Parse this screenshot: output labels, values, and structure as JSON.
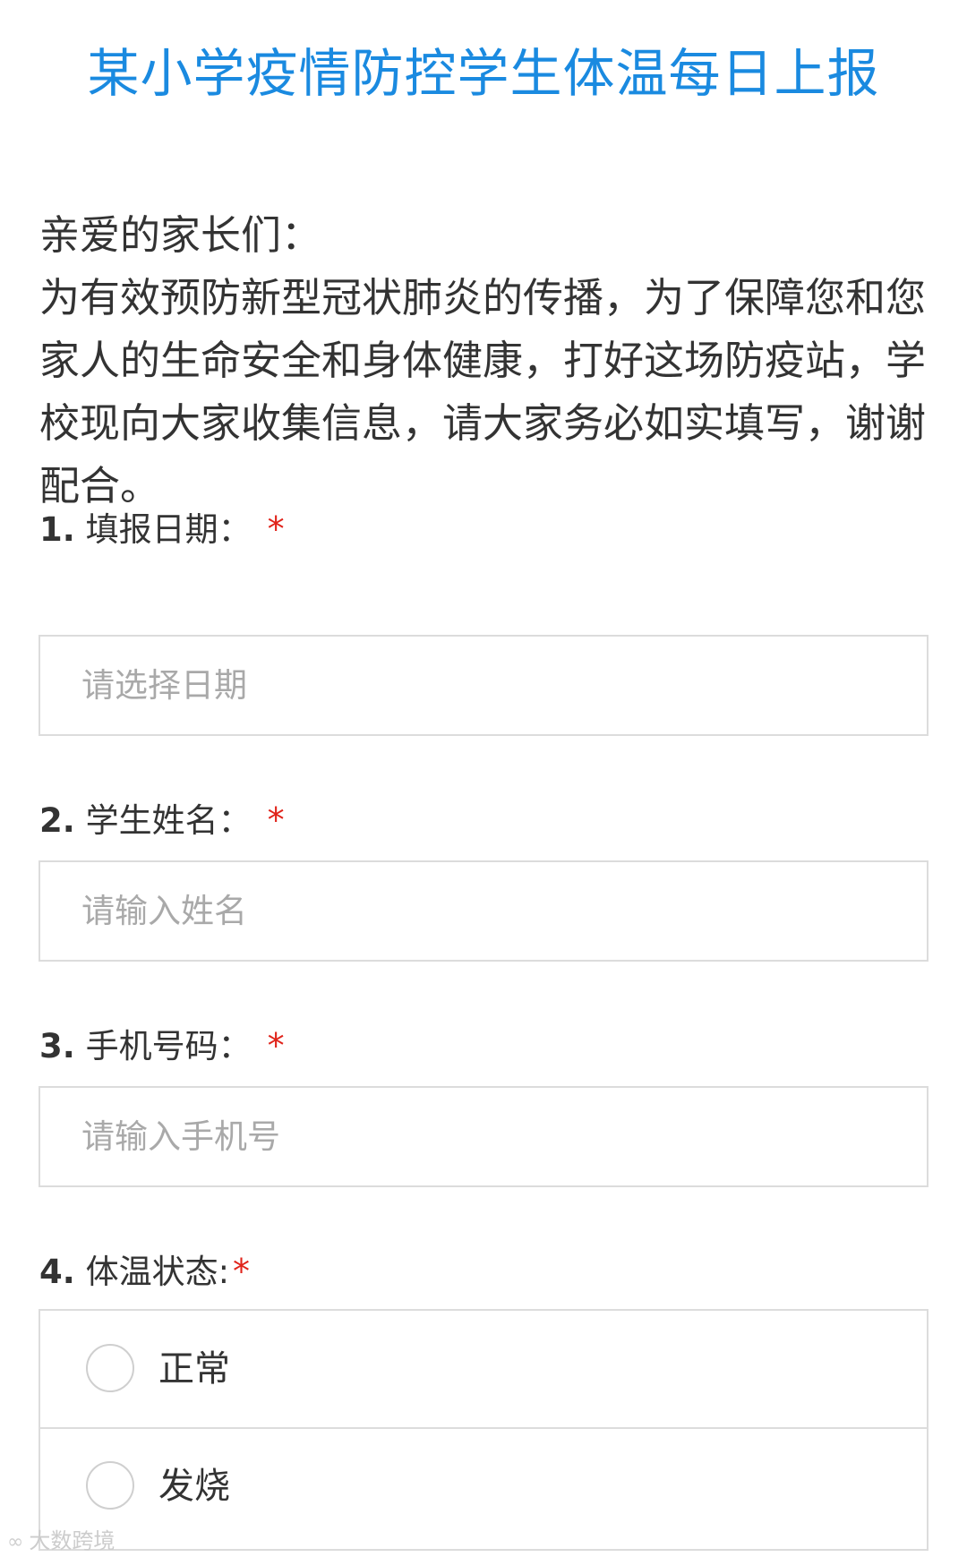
{
  "form": {
    "title": "某小学疫情防控学生体温每日上报",
    "greeting": "亲爱的家长们：",
    "intro": "为有效预防新型冠状肺炎的传播，为了保障您和您家人的生命安全和身体健康，打好这场防疫站，学校现向大家收集信息，请大家务必如实填写，谢谢配合。"
  },
  "questions": [
    {
      "number": "1.",
      "label": "填报日期：",
      "required": "*",
      "placeholder": "请选择日期",
      "value": ""
    },
    {
      "number": "2.",
      "label": "学生姓名：",
      "required": "*",
      "placeholder": "请输入姓名",
      "value": ""
    },
    {
      "number": "3.",
      "label": "手机号码：",
      "required": "*",
      "placeholder": "请输入手机号",
      "value": ""
    },
    {
      "number": "4.",
      "label": "体温状态:",
      "required": "*",
      "options": [
        "正常",
        "发烧"
      ]
    }
  ],
  "watermark": {
    "icon": "watermark-logo-icon",
    "text": "大数跨境"
  },
  "colors": {
    "title": "#1a8ae0",
    "required": "#e0241b",
    "border": "#dcdcdc",
    "placeholder": "#a9a9a9",
    "text": "#333333"
  }
}
